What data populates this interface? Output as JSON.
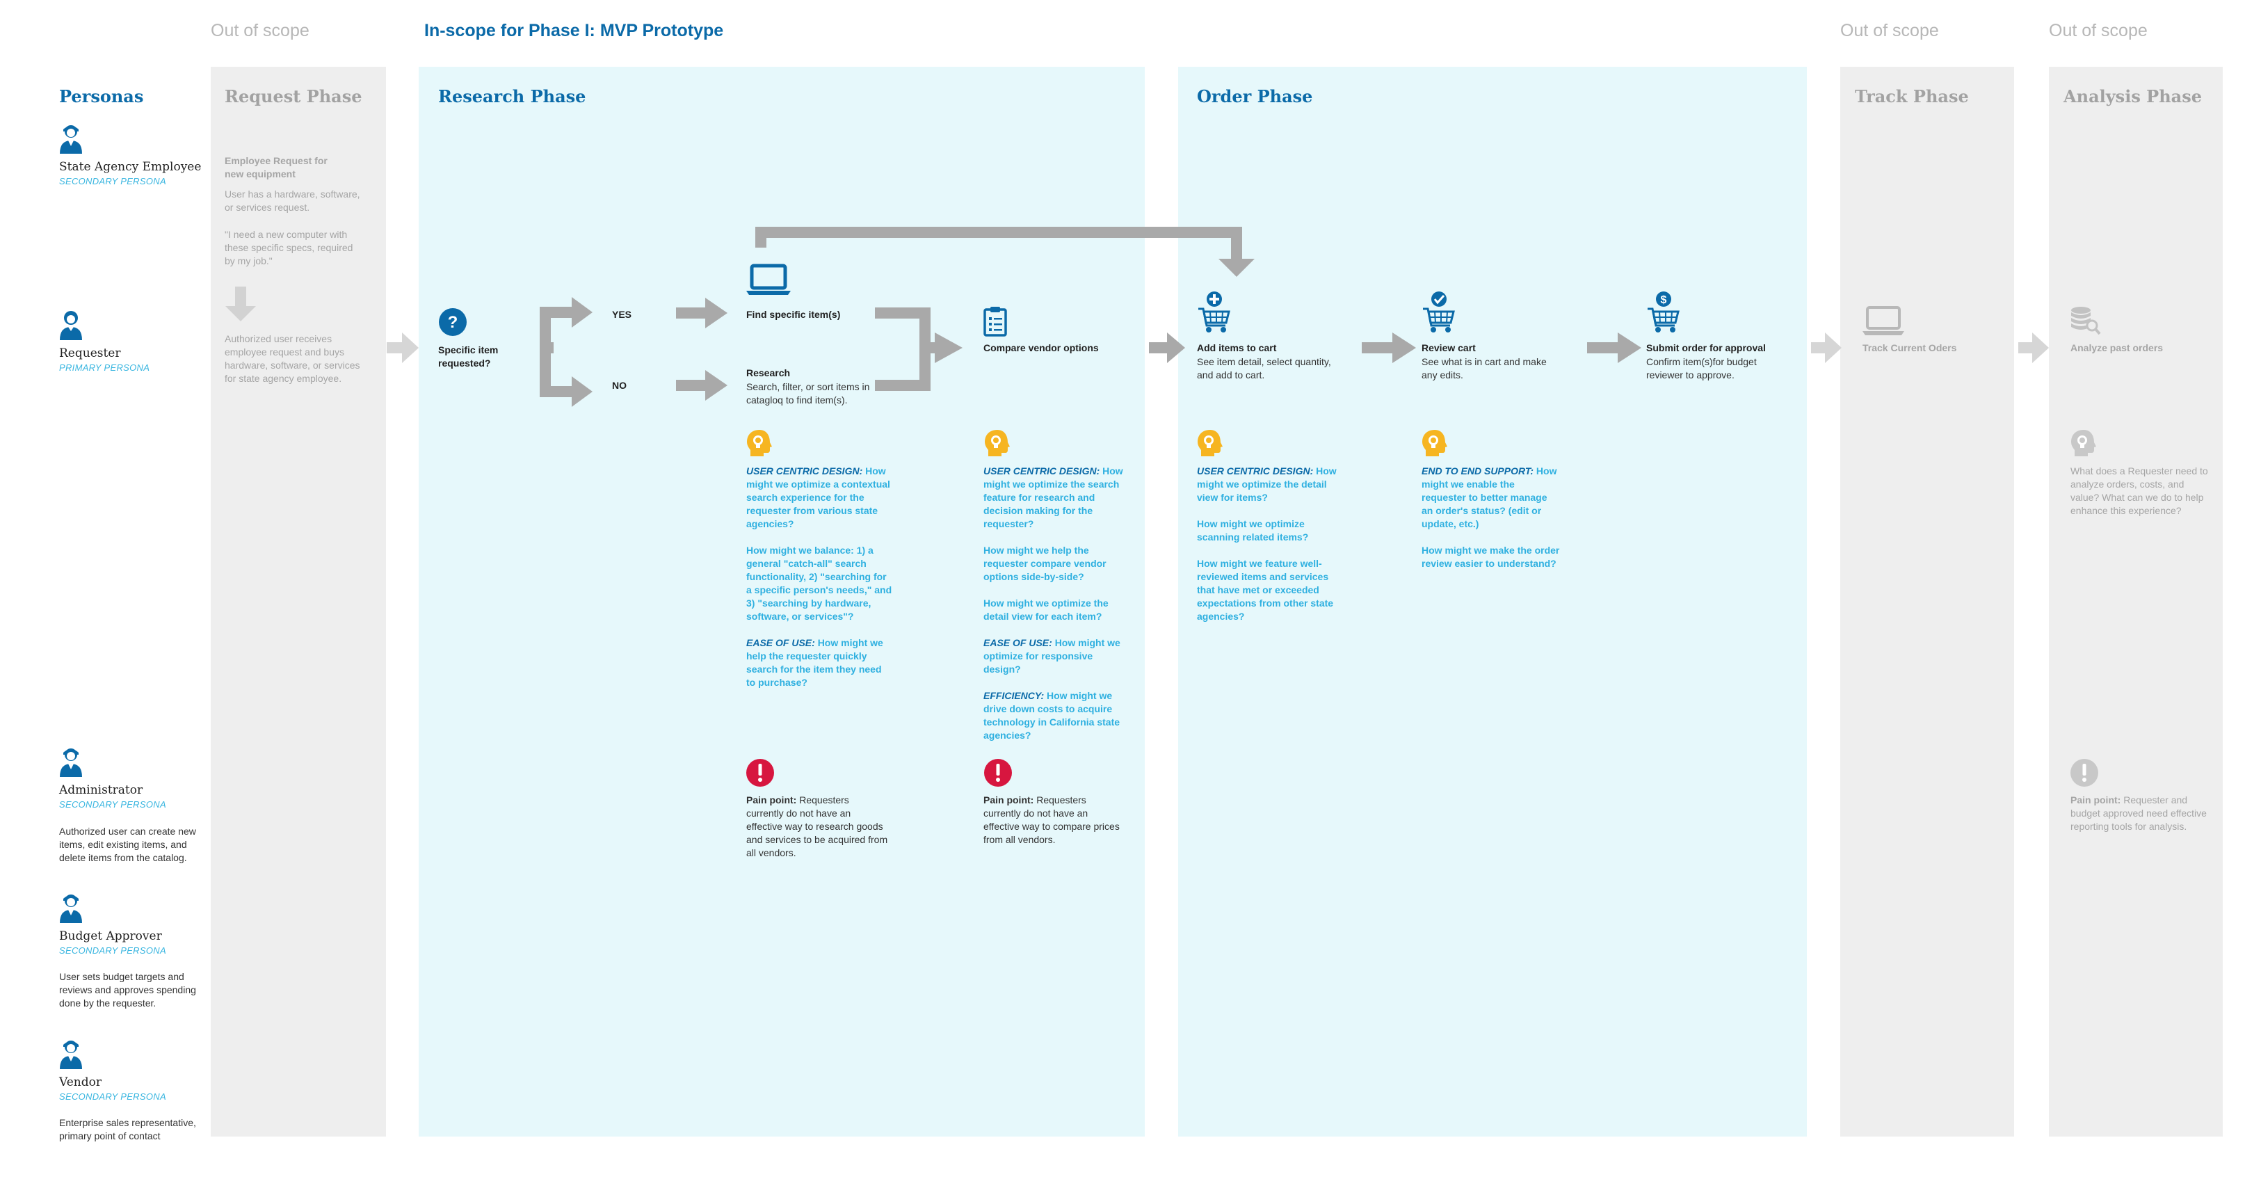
{
  "scope_labels": {
    "out1": "Out of scope",
    "in": "In-scope for Phase I: MVP Prototype",
    "out2": "Out of scope",
    "out3": "Out of scope"
  },
  "personas": {
    "title": "Personas",
    "state_agency": {
      "name": "State Agency Employee",
      "role": "SECONDARY PERSONA"
    },
    "requester": {
      "name": "Requester",
      "role": "PRIMARY PERSONA"
    },
    "administrator": {
      "name": "Administrator",
      "role": "SECONDARY PERSONA",
      "desc": "Authorized user can create new items, edit existing items, and delete items from the catalog."
    },
    "budget_approver": {
      "name": "Budget Approver",
      "role": "SECONDARY PERSONA",
      "desc": "User sets budget targets and reviews and approves spending done by the requester."
    },
    "vendor": {
      "name": "Vendor",
      "role": "SECONDARY PERSONA",
      "desc": "Enterprise sales representative, primary point of contact"
    }
  },
  "phases": {
    "request": "Request Phase",
    "research": "Research Phase",
    "order": "Order Phase",
    "track": "Track Phase",
    "analysis": "Analysis Phase"
  },
  "request_phase": {
    "title": "Employee Request for new equipment",
    "desc": "User has a hardware, software, or services request.",
    "quote": "\"I need a new computer with these specific specs, required by my job.\"",
    "desc2": "Authorized user receives employee request and buys hardware, software, or services for state agency employee."
  },
  "research_phase": {
    "decision": "Specific item requested?",
    "yes": "YES",
    "no": "NO",
    "find": "Find specific item(s)",
    "research_title": "Research",
    "research_desc": "Search, filter, or sort items in catagloq to find item(s).",
    "compare": "Compare vendor options",
    "col1_q1_lead": "USER CENTRIC DESIGN:",
    "col1_q1": "How might we optimize a contextual search experience for the requester from various state agencies?",
    "col1_q2": "How might we balance: 1) a general \"catch-all\" search functionality, 2) \"searching for a specific person's needs,\" and 3) \"searching by hardware, software, or services\"?",
    "col1_q3_lead": "EASE OF USE:",
    "col1_q3": "How might we help the requester quickly search for the item they need to purchase?",
    "col1_pain_lead": "Pain point:",
    "col1_pain": "Requesters currently do not have an effective way to research goods and services to be acquired from all vendors.",
    "col2_q1_lead": "USER CENTRIC DESIGN:",
    "col2_q1": "How might we optimize the search feature for research and decision making for the requester?",
    "col2_q2": "How might we help the requester compare vendor options side-by-side?",
    "col2_q3": "How might we optimize the detail view for each item?",
    "col2_q4_lead": "EASE OF USE:",
    "col2_q4": "How might we optimize for responsive design?",
    "col2_q5_lead": "EFFICIENCY:",
    "col2_q5": "How might we drive down costs to acquire technology in California state agencies?",
    "col2_pain_lead": "Pain point:",
    "col2_pain": "Requesters currently do not have an effective way to compare prices from all vendors."
  },
  "order_phase": {
    "add_title": "Add items to cart",
    "add_desc": "See item detail, select quantity, and add to cart.",
    "review_title": "Review cart",
    "review_desc": "See what is in cart and make any edits.",
    "submit_title": "Submit order for approval",
    "submit_desc": "Confirm item(s)for budget reviewer to approve.",
    "col1_q1_lead": "USER CENTRIC DESIGN:",
    "col1_q1": "How might we optimize the detail view for items?",
    "col1_q2": "How might we optimize scanning related items?",
    "col1_q3": "How might we feature well-reviewed items and services that have met or exceeded expectations from other state agencies?",
    "col2_q1_lead": "END TO END SUPPORT:",
    "col2_q1": "How might we enable the requester to better manage an order's status? (edit or update, etc.)",
    "col2_q2": "How might we make the order review easier to understand?"
  },
  "track_phase": {
    "step": "Track Current Oders"
  },
  "analysis_phase": {
    "step": "Analyze past orders",
    "question": "What does a Requester need to analyze orders, costs, and value? What can we do to help enhance this experience?",
    "pain_lead": "Pain point:",
    "pain": "Requester and budget approved need effective reporting tools for analysis."
  },
  "icons": {
    "persona": "person-icon",
    "question": "question-circle-icon",
    "laptop": "laptop-icon",
    "clipboard": "clipboard-icon",
    "cart_plus": "cart-add-icon",
    "cart_check": "cart-check-icon",
    "cart_dollar": "cart-dollar-icon",
    "idea": "lightbulb-head-icon",
    "alert": "exclamation-circle-icon",
    "database": "database-search-icon"
  },
  "colors": {
    "brand_blue": "#0b6aa8",
    "light_blue": "#2fb0e0",
    "phase_blue_bg": "#e6f8fb",
    "phase_gray_bg": "#eeeeee",
    "arrow_gray": "#a9a9a9",
    "idea_yellow": "#f6b521",
    "alert_red": "#d7163f"
  }
}
